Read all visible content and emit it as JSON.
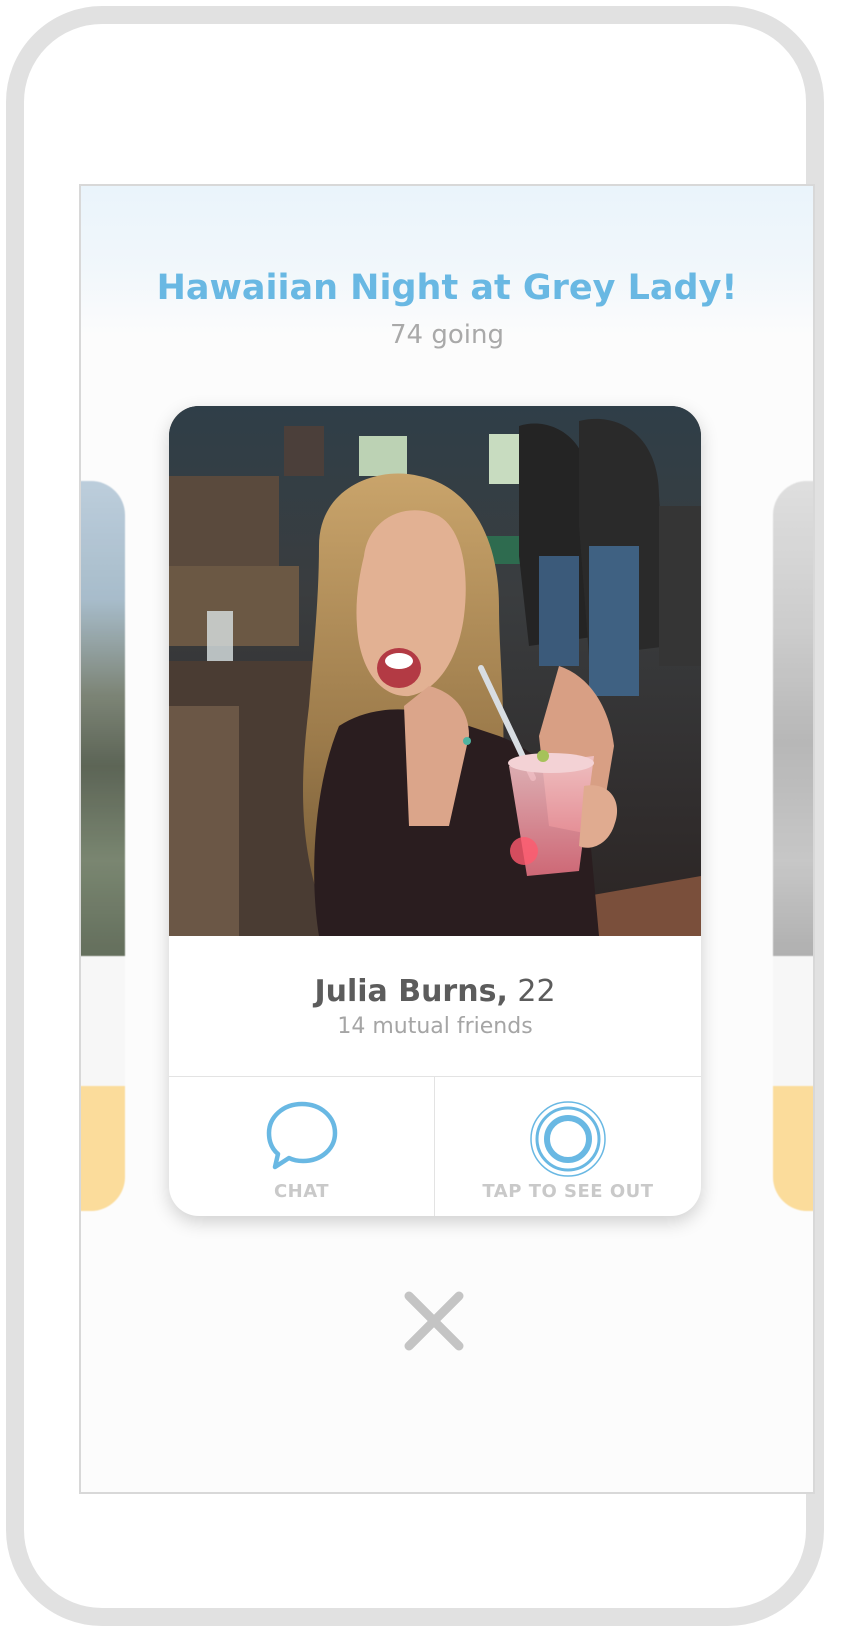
{
  "event": {
    "title": "Hawaiian Night at Grey Lady!",
    "going": "74 going"
  },
  "profile": {
    "name": "Julia Burns,",
    "age": " 22",
    "mutual_friends": "14 mutual friends"
  },
  "actions": {
    "chat_label": "CHAT",
    "tap_label": "TAP TO SEE OUT"
  },
  "icons": {
    "chat": "chat-bubble-icon",
    "tap": "concentric-rings-icon",
    "close": "close-x-icon"
  },
  "colors": {
    "accent": "#69b8e3",
    "muted_text": "#a9a9a9",
    "side_card_bar": "#fbd991",
    "close_icon": "#c4c4c4"
  }
}
